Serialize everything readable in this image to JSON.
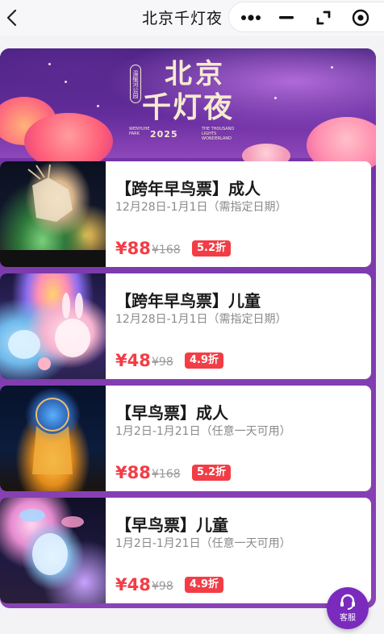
{
  "header": {
    "title": "北京千灯夜",
    "icons": [
      "back-chevron-icon",
      "more-dots-icon",
      "minimize-icon",
      "scan-corner-icon",
      "close-circle-icon"
    ]
  },
  "banner": {
    "title_line1": "北京",
    "title_line2": "千灯夜",
    "year": "2025",
    "badge": "温榆河公园",
    "sub_left": "WENYUHE PARK",
    "sub_right": "THE THOUSAND LIGHTS WONDERLAND"
  },
  "tickets": [
    {
      "name": "【跨年早鸟票】成人",
      "date": "12月28日-1月1日（需指定日期）",
      "price": "¥88",
      "original_price": "¥168",
      "discount": "5.2折"
    },
    {
      "name": "【跨年早鸟票】儿童",
      "date": "12月28日-1月1日（需指定日期）",
      "price": "¥48",
      "original_price": "¥98",
      "discount": "4.9折"
    },
    {
      "name": "【早鸟票】成人",
      "date": "1月2日-1月21日（任意一天可用）",
      "price": "¥88",
      "original_price": "¥168",
      "discount": "5.2折"
    },
    {
      "name": "【早鸟票】儿童",
      "date": "1月2日-1月21日（任意一天可用）",
      "price": "¥48",
      "original_price": "¥98",
      "discount": "4.9折"
    }
  ],
  "customer_service": {
    "label": "客服"
  },
  "colors": {
    "accent_red": "#f23d46",
    "panel_purple": "#7c3aac",
    "cs_purple": "#7a2bbd"
  }
}
